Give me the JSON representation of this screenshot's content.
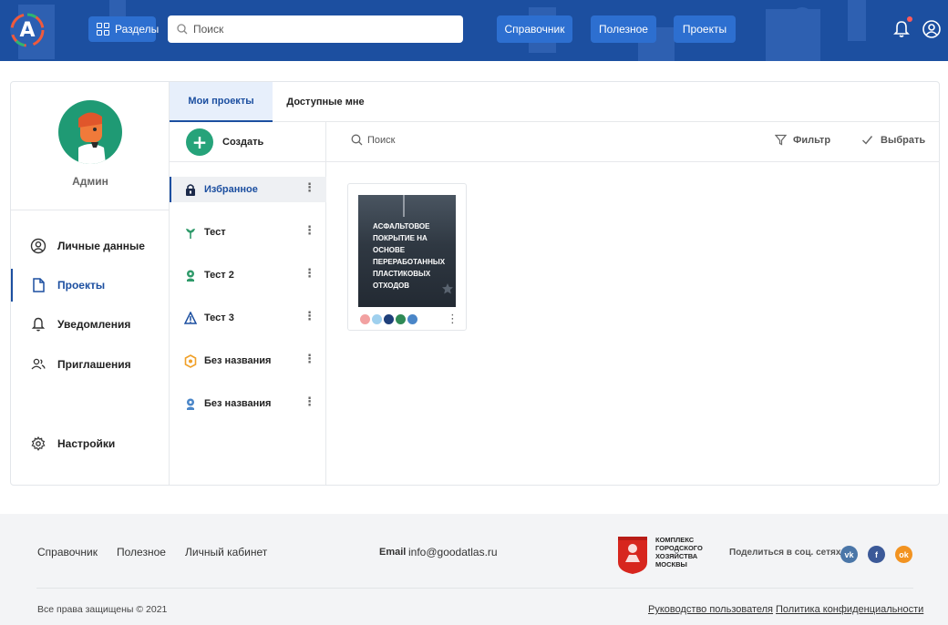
{
  "header": {
    "logo_letter": "A",
    "sections_label": "Разделы",
    "search_placeholder": "Поиск",
    "nav": [
      "Справочник",
      "Полезное",
      "Проекты"
    ],
    "notification_dot": true,
    "colors": {
      "bar": "#1c4fa0",
      "button": "#2d6fd0",
      "accent_green": "#26a37a"
    }
  },
  "profile": {
    "name": "Админ",
    "menu": [
      {
        "label": "Личные данные",
        "icon": "user-circle-icon",
        "active": false
      },
      {
        "label": "Проекты",
        "icon": "document-icon",
        "active": true
      },
      {
        "label": "Уведомления",
        "icon": "bell-icon",
        "active": false
      },
      {
        "label": "Приглашения",
        "icon": "users-icon",
        "active": false
      }
    ],
    "settings_label": "Настройки"
  },
  "tabs": [
    {
      "label": "Мои проекты",
      "active": true
    },
    {
      "label": "Доступные мне",
      "active": false
    }
  ],
  "folders": {
    "create_label": "Создать",
    "items": [
      {
        "label": "Избранное",
        "icon": "lock-icon",
        "active": true
      },
      {
        "label": "Тест",
        "icon": "sprout-icon",
        "active": false
      },
      {
        "label": "Тест 2",
        "icon": "plant-icon",
        "active": false
      },
      {
        "label": "Тест 3",
        "icon": "triangle-icon",
        "active": false
      },
      {
        "label": "Без названия",
        "icon": "hexagon-icon",
        "active": false
      },
      {
        "label": "Без названия",
        "icon": "pin-icon",
        "active": false
      }
    ]
  },
  "toolbar": {
    "search_label": "Поиск",
    "filter_label": "Фильтр",
    "select_label": "Выбрать"
  },
  "project": {
    "title": "Асфальтовое покрытие на основе переработанных пластиковых отходов",
    "tag_colors": [
      "#f2a1a1",
      "#9fd0ee",
      "#1f3f7a",
      "#2f8a56",
      "#4a86c8"
    ]
  },
  "footer": {
    "links": [
      "Справочник",
      "Полезное",
      "Личный кабинет"
    ],
    "email_label": "Email",
    "email": "info@goodatlas.ru",
    "org": "Комплекс городского хозяйства Москвы",
    "share_label": "Поделиться в соц. сетях",
    "socials": [
      {
        "name": "vk",
        "glyph": "vk",
        "color": "#4a76a8"
      },
      {
        "name": "facebook",
        "glyph": "f",
        "color": "#3b5998"
      },
      {
        "name": "odnoklassniki",
        "glyph": "ok",
        "color": "#f29321"
      }
    ],
    "copyright": "Все права защищены © 2021",
    "bottom_links": [
      "Руководство пользователя",
      "Политика конфиденциальности"
    ]
  }
}
